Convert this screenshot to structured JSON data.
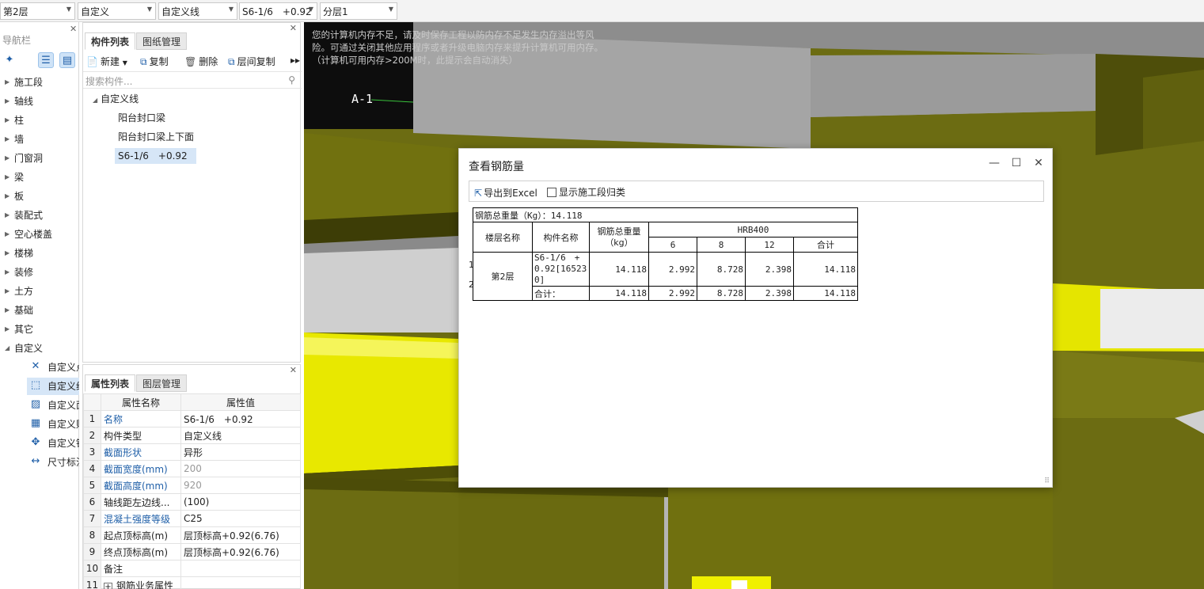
{
  "topbar": {
    "floor": "第2层",
    "category": "自定义",
    "type": "自定义线",
    "component": "S6-1/6　+0.92",
    "layer": "分层1"
  },
  "nav": {
    "title": "导航栏",
    "items": [
      "施工段",
      "轴线",
      "柱",
      "墙",
      "门窗洞",
      "梁",
      "板",
      "装配式",
      "空心楼盖",
      "楼梯",
      "装修",
      "土方",
      "基础",
      "其它",
      "自定义"
    ],
    "subitems": [
      "自定义点",
      "自定义线",
      "自定义面",
      "自定义贴面",
      "自定义钢筋",
      "尺寸标注"
    ]
  },
  "component_list": {
    "tabs": [
      "构件列表",
      "图纸管理"
    ],
    "toolbar": {
      "new": "新建",
      "copy": "复制",
      "delete": "删除",
      "floor_copy": "层间复制"
    },
    "search_placeholder": "搜索构件...",
    "tree_root": "自定义线",
    "tree_items": [
      "阳台封口梁",
      "阳台封口梁上下面",
      "S6-1/6　+0.92"
    ]
  },
  "properties": {
    "tabs": [
      "属性列表",
      "图层管理"
    ],
    "headers": [
      "属性名称",
      "属性值"
    ],
    "rows": [
      {
        "n": "1",
        "name": "名称",
        "value": "S6-1/6　+0.92"
      },
      {
        "n": "2",
        "name": "构件类型",
        "value": "自定义线"
      },
      {
        "n": "3",
        "name": "截面形状",
        "value": "异形"
      },
      {
        "n": "4",
        "name": "截面宽度(mm)",
        "value": "200"
      },
      {
        "n": "5",
        "name": "截面高度(mm)",
        "value": "920"
      },
      {
        "n": "6",
        "name": "轴线距左边线...",
        "value": "(100)"
      },
      {
        "n": "7",
        "name": "混凝土强度等级",
        "value": "C25"
      },
      {
        "n": "8",
        "name": "起点顶标高(m)",
        "value": "层顶标高+0.92(6.76)"
      },
      {
        "n": "9",
        "name": "终点顶标高(m)",
        "value": "层顶标高+0.92(6.76)"
      },
      {
        "n": "10",
        "name": "备注",
        "value": ""
      },
      {
        "n": "11",
        "name": "钢筋业务属性",
        "value": ""
      }
    ]
  },
  "viewport": {
    "warning": "您的计算机内存不足，请及时保存工程以防内存不足发生内存溢出等风险。可通过关闭其他应用程序或者升级电脑内存来提升计算机可用内存。（计算机可用内存>200M时，此提示会自动消失）",
    "axis_label": "A-1"
  },
  "dialog": {
    "title": "查看钢筋量",
    "export_label": "导出到Excel",
    "checkbox_label": "显示施工段归类",
    "table": {
      "total_weight_label": "钢筋总重量（Kg）：14.118",
      "col_floor": "楼层名称",
      "col_component": "构件名称",
      "col_total": "钢筋总重量（kg）",
      "grade": "HRB400",
      "diameters": [
        "6",
        "8",
        "12",
        "合计"
      ],
      "row_numbers": [
        "1",
        "2"
      ],
      "floor_name": "第2层",
      "row1": {
        "component": "S6-1/6　+0.92[165230]",
        "total": "14.118",
        "d6": "2.992",
        "d8": "8.728",
        "d12": "2.398",
        "sum": "14.118"
      },
      "row2": {
        "component": "合计：",
        "total": "14.118",
        "d6": "2.992",
        "d8": "8.728",
        "d12": "2.398",
        "sum": "14.118"
      }
    }
  }
}
